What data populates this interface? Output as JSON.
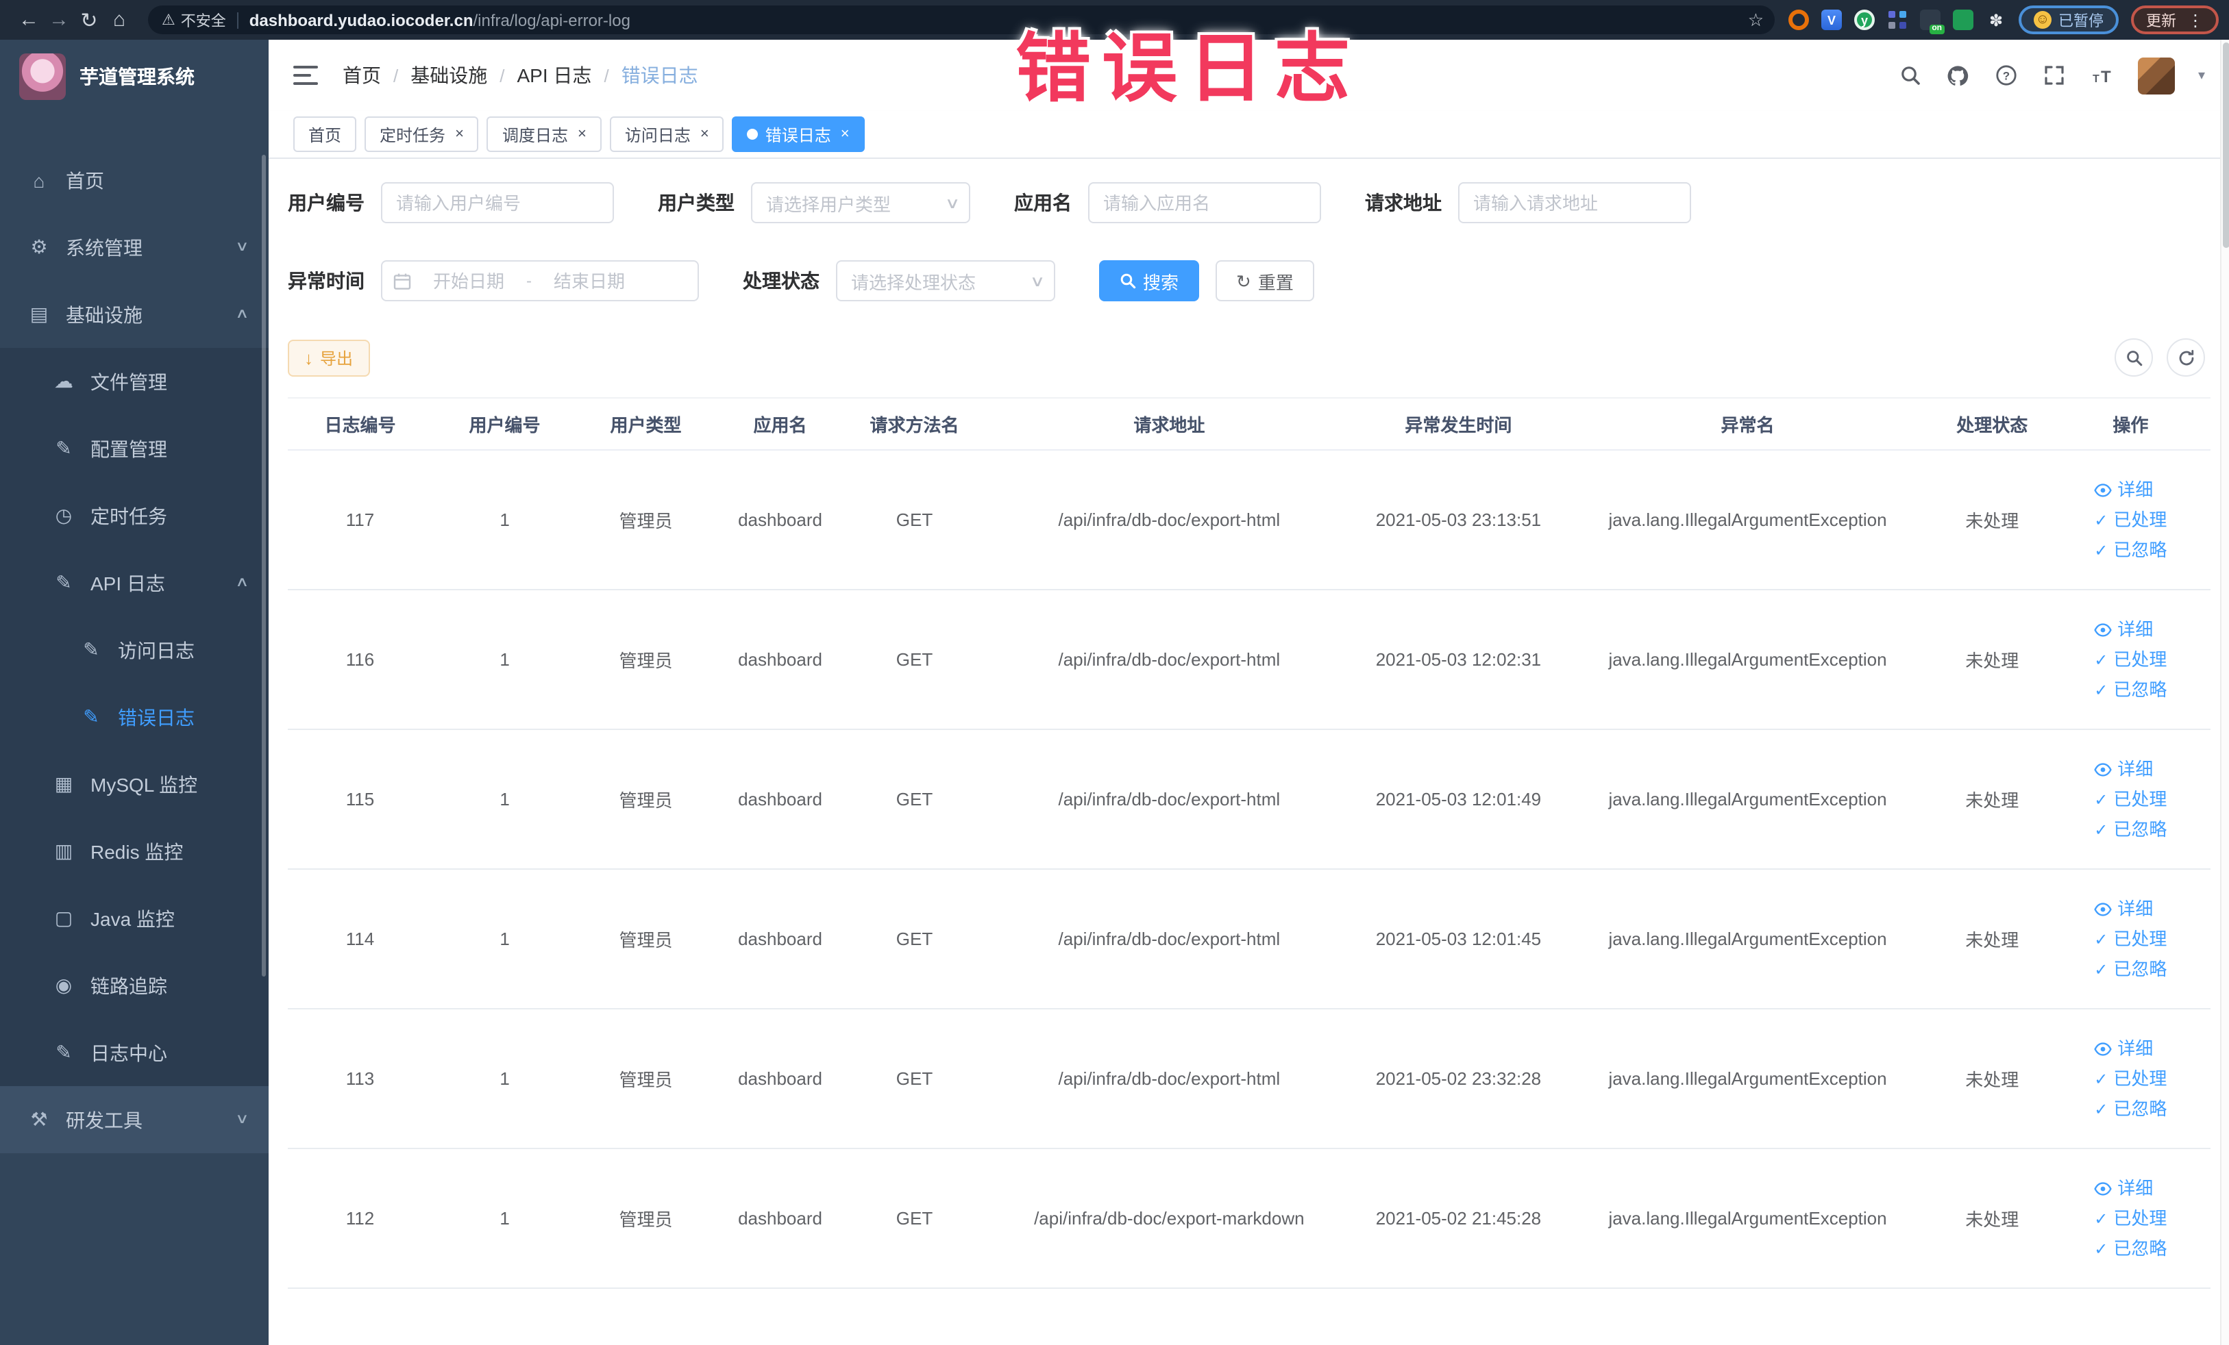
{
  "overlay_title": "错误日志",
  "browser": {
    "security_label": "不安全",
    "url_host": "dashboard.yudao.iocoder.cn",
    "url_path": "/infra/log/api-error-log",
    "paused_badge": "已暂停",
    "update_badge": "更新"
  },
  "icons": {
    "back": "←",
    "forward": "→",
    "reload": "↻",
    "home": "⌂",
    "warning": "⚠",
    "star": "☆",
    "paw": "✽",
    "monica": "y",
    "emoji": "☺",
    "kebab": "⋮",
    "menu-home": "⌂",
    "menu-system": "⚙",
    "menu-infra": "▤",
    "menu-file": "☁",
    "menu-config": "✎",
    "menu-timer": "◷",
    "menu-apilog": "✎",
    "menu-access": "✎",
    "menu-error": "✎",
    "menu-mysql": "▦",
    "menu-redis": "▥",
    "menu-java": "▢",
    "menu-trace": "◉",
    "menu-logcenter": "✎",
    "menu-devtools": "⚒",
    "chevron-down": "∨",
    "chevron-up": "∧",
    "caret-down": "▾",
    "select-caret": "∨",
    "check": "✓",
    "reset": "↻",
    "export": "↓"
  },
  "sidebar": {
    "app_title": "芋道管理系统",
    "items": [
      {
        "key": "home",
        "label": "首页",
        "icon": "menu-home",
        "level": 0
      },
      {
        "key": "system-mgmt",
        "label": "系统管理",
        "icon": "menu-system",
        "level": 0,
        "chevron": "down"
      },
      {
        "key": "infrastructure",
        "label": "基础设施",
        "icon": "menu-infra",
        "level": 0,
        "chevron": "up"
      },
      {
        "key": "file-mgmt",
        "label": "文件管理",
        "icon": "menu-file",
        "level": 1
      },
      {
        "key": "config-mgmt",
        "label": "配置管理",
        "icon": "menu-config",
        "level": 1
      },
      {
        "key": "scheduled-task",
        "label": "定时任务",
        "icon": "menu-timer",
        "level": 1
      },
      {
        "key": "api-log",
        "label": "API 日志",
        "icon": "menu-apilog",
        "level": 1,
        "chevron": "up"
      },
      {
        "key": "access-log",
        "label": "访问日志",
        "icon": "menu-access",
        "level": 2
      },
      {
        "key": "error-log",
        "label": "错误日志",
        "icon": "menu-error",
        "level": 2,
        "active": true
      },
      {
        "key": "mysql-monitor",
        "label": "MySQL 监控",
        "icon": "menu-mysql",
        "level": 1
      },
      {
        "key": "redis-monitor",
        "label": "Redis 监控",
        "icon": "menu-redis",
        "level": 1
      },
      {
        "key": "java-monitor",
        "label": "Java 监控",
        "icon": "menu-java",
        "level": 1
      },
      {
        "key": "trace",
        "label": "链路追踪",
        "icon": "menu-trace",
        "level": 1
      },
      {
        "key": "log-center",
        "label": "日志中心",
        "icon": "menu-logcenter",
        "level": 1
      },
      {
        "key": "dev-tools",
        "label": "研发工具",
        "icon": "menu-devtools",
        "level": 0,
        "chevron": "down",
        "highlight": true
      }
    ]
  },
  "header": {
    "breadcrumb": [
      "首页",
      "基础设施",
      "API 日志",
      "错误日志"
    ],
    "breadcrumb_separator": "/"
  },
  "tabs": [
    {
      "label": "首页",
      "closable": false,
      "active": false
    },
    {
      "label": "定时任务",
      "closable": true,
      "active": false
    },
    {
      "label": "调度日志",
      "closable": true,
      "active": false
    },
    {
      "label": "访问日志",
      "closable": true,
      "active": false
    },
    {
      "label": "错误日志",
      "closable": true,
      "active": true
    }
  ],
  "filters": {
    "user_id": {
      "label": "用户编号",
      "placeholder": "请输入用户编号"
    },
    "user_type": {
      "label": "用户类型",
      "placeholder": "请选择用户类型"
    },
    "app_name": {
      "label": "应用名",
      "placeholder": "请输入应用名"
    },
    "request_url": {
      "label": "请求地址",
      "placeholder": "请输入请求地址"
    },
    "exception_time": {
      "label": "异常时间",
      "start_placeholder": "开始日期",
      "separator": "-",
      "end_placeholder": "结束日期"
    },
    "process_status": {
      "label": "处理状态",
      "placeholder": "请选择处理状态"
    },
    "search_label": "搜索",
    "reset_label": "重置"
  },
  "toolbar": {
    "export_label": "导出"
  },
  "table": {
    "columns": [
      {
        "key": "id",
        "label": "日志编号"
      },
      {
        "key": "user_id",
        "label": "用户编号"
      },
      {
        "key": "user_type",
        "label": "用户类型"
      },
      {
        "key": "app_name",
        "label": "应用名"
      },
      {
        "key": "method",
        "label": "请求方法名"
      },
      {
        "key": "url",
        "label": "请求地址"
      },
      {
        "key": "time",
        "label": "异常发生时间"
      },
      {
        "key": "exception",
        "label": "异常名"
      },
      {
        "key": "status",
        "label": "处理状态"
      },
      {
        "key": "actions",
        "label": "操作"
      }
    ],
    "row_actions": [
      {
        "label": "详细",
        "icon": "eye"
      },
      {
        "label": "已处理",
        "icon": "check"
      },
      {
        "label": "已忽略",
        "icon": "check"
      }
    ],
    "rows": [
      {
        "id": "117",
        "user_id": "1",
        "user_type": "管理员",
        "app_name": "dashboard",
        "method": "GET",
        "url": "/api/infra/db-doc/export-html",
        "time": "2021-05-03 23:13:51",
        "exception": "java.lang.IllegalArgumentException",
        "status": "未处理"
      },
      {
        "id": "116",
        "user_id": "1",
        "user_type": "管理员",
        "app_name": "dashboard",
        "method": "GET",
        "url": "/api/infra/db-doc/export-html",
        "time": "2021-05-03 12:02:31",
        "exception": "java.lang.IllegalArgumentException",
        "status": "未处理"
      },
      {
        "id": "115",
        "user_id": "1",
        "user_type": "管理员",
        "app_name": "dashboard",
        "method": "GET",
        "url": "/api/infra/db-doc/export-html",
        "time": "2021-05-03 12:01:49",
        "exception": "java.lang.IllegalArgumentException",
        "status": "未处理"
      },
      {
        "id": "114",
        "user_id": "1",
        "user_type": "管理员",
        "app_name": "dashboard",
        "method": "GET",
        "url": "/api/infra/db-doc/export-html",
        "time": "2021-05-03 12:01:45",
        "exception": "java.lang.IllegalArgumentException",
        "status": "未处理"
      },
      {
        "id": "113",
        "user_id": "1",
        "user_type": "管理员",
        "app_name": "dashboard",
        "method": "GET",
        "url": "/api/infra/db-doc/export-html",
        "time": "2021-05-02 23:32:28",
        "exception": "java.lang.IllegalArgumentException",
        "status": "未处理"
      },
      {
        "id": "112",
        "user_id": "1",
        "user_type": "管理员",
        "app_name": "dashboard",
        "method": "GET",
        "url": "/api/infra/db-doc/export-markdown",
        "time": "2021-05-02 21:45:28",
        "exception": "java.lang.IllegalArgumentException",
        "status": "未处理"
      }
    ]
  }
}
